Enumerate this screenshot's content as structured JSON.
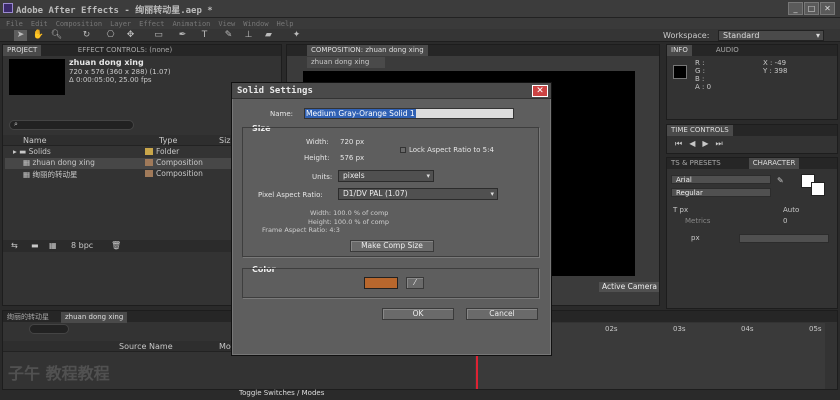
{
  "window": {
    "title": "Adobe After Effects - 绚丽转动星.aep *"
  },
  "menu": [
    "File",
    "Edit",
    "Composition",
    "Layer",
    "Effect",
    "Animation",
    "View",
    "Window",
    "Help"
  ],
  "workspace": {
    "label": "Workspace:",
    "value": "Standard"
  },
  "project": {
    "tab": "PROJECT",
    "tab2": "EFFECT CONTROLS: (none)",
    "item_name": "zhuan dong xing",
    "item_info1": "720 x 576  (360 x 288) (1.07)",
    "item_info2": "Δ 0:00:05:00, 25.00 fps",
    "col_name": "Name",
    "col_type": "Type",
    "col_size": "Siz",
    "rows": [
      {
        "name": "Solids",
        "type": "Folder"
      },
      {
        "name": "zhuan dong xing",
        "type": "Composition"
      },
      {
        "name": "绚丽的转动星",
        "type": "Composition"
      }
    ],
    "bpc": "8 bpc"
  },
  "comp": {
    "tab": "COMPOSITION: zhuan dong xing",
    "subtab": "zhuan dong xing",
    "camera": "Active Camera"
  },
  "info": {
    "tab": "INFO",
    "tab2": "AUDIO",
    "r": "R :",
    "g": "G :",
    "b": "B :",
    "a": "A : 0",
    "x": "X : -49",
    "y": "Y : 398"
  },
  "time_controls": {
    "tab": "TIME CONTROLS"
  },
  "character": {
    "tab_presets": "TS & PRESETS",
    "tab": "CHARACTER",
    "font": "Arial",
    "style": "Regular",
    "size": "px",
    "leading": "Auto",
    "metrics": "Metrics",
    "tracking": "0",
    "stroke": "px"
  },
  "timeline": {
    "tab1": "绚丽的转动星",
    "tab2": "zhuan dong xing",
    "col_source": "Source Name",
    "col_mo": "Mo",
    "ticks": [
      "02s",
      "03s",
      "04s",
      "05s"
    ],
    "toggle": "Toggle Switches / Modes"
  },
  "watermark": {
    "text": "子午 教程教程"
  },
  "dialog": {
    "title": "Solid Settings",
    "name_label": "Name:",
    "name_value": "Medium Gray-Orange Solid 1",
    "size_section": "Size",
    "width_label": "Width:",
    "width_value": "720 px",
    "height_label": "Height:",
    "height_value": "576 px",
    "lock_label": "Lock Aspect Ratio to 5:4",
    "units_label": "Units:",
    "units_value": "pixels",
    "par_label": "Pixel Aspect Ratio:",
    "par_value": "D1/DV PAL (1.07)",
    "info_width": "Width: 100.0 % of comp",
    "info_height": "Height: 100.0 % of comp",
    "info_far": "Frame Aspect Ratio: 4:3",
    "make_comp_size": "Make Comp Size",
    "color_section": "Color",
    "swatch": "#b8672d",
    "ok": "OK",
    "cancel": "Cancel"
  }
}
